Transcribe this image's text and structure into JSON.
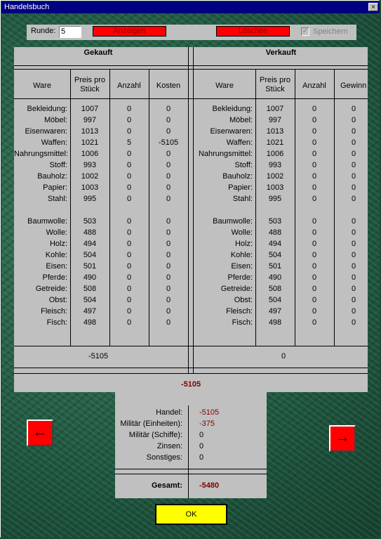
{
  "window": {
    "title": "Handelsbuch",
    "close_glyph": "×"
  },
  "top": {
    "runde_label": "Runde:",
    "runde_value": "5",
    "anzeigen_label": "Anzeigen",
    "loeschen_label": "Löschen",
    "speichern_label": "Speichern",
    "speichern_checked": true
  },
  "bought": {
    "title": "Gekauft",
    "headers": {
      "ware": "Ware",
      "preis": "Preis pro Stück",
      "anzahl": "Anzahl",
      "kosten": "Kosten"
    },
    "rows": [
      {
        "ware": "Bekleidung:",
        "preis": "1007",
        "anzahl": "0",
        "wert": "0"
      },
      {
        "ware": "Möbel:",
        "preis": "997",
        "anzahl": "0",
        "wert": "0"
      },
      {
        "ware": "Eisenwaren:",
        "preis": "1013",
        "anzahl": "0",
        "wert": "0"
      },
      {
        "ware": "Waffen:",
        "preis": "1021",
        "anzahl": "5",
        "wert": "-5105"
      },
      {
        "ware": "Nahrungsmittel:",
        "preis": "1006",
        "anzahl": "0",
        "wert": "0"
      },
      {
        "ware": "Stoff:",
        "preis": "993",
        "anzahl": "0",
        "wert": "0"
      },
      {
        "ware": "Bauholz:",
        "preis": "1002",
        "anzahl": "0",
        "wert": "0"
      },
      {
        "ware": "Papier:",
        "preis": "1003",
        "anzahl": "0",
        "wert": "0"
      },
      {
        "ware": "Stahl:",
        "preis": "995",
        "anzahl": "0",
        "wert": "0"
      },
      {
        "ware": "Baumwolle:",
        "preis": "503",
        "anzahl": "0",
        "wert": "0"
      },
      {
        "ware": "Wolle:",
        "preis": "488",
        "anzahl": "0",
        "wert": "0"
      },
      {
        "ware": "Holz:",
        "preis": "494",
        "anzahl": "0",
        "wert": "0"
      },
      {
        "ware": "Kohle:",
        "preis": "504",
        "anzahl": "0",
        "wert": "0"
      },
      {
        "ware": "Eisen:",
        "preis": "501",
        "anzahl": "0",
        "wert": "0"
      },
      {
        "ware": "Pferde:",
        "preis": "490",
        "anzahl": "0",
        "wert": "0"
      },
      {
        "ware": "Getreide:",
        "preis": "508",
        "anzahl": "0",
        "wert": "0"
      },
      {
        "ware": "Obst:",
        "preis": "504",
        "anzahl": "0",
        "wert": "0"
      },
      {
        "ware": "Fleisch:",
        "preis": "497",
        "anzahl": "0",
        "wert": "0"
      },
      {
        "ware": "Fisch:",
        "preis": "498",
        "anzahl": "0",
        "wert": "0"
      }
    ],
    "total": "-5105"
  },
  "sold": {
    "title": "Verkauft",
    "headers": {
      "ware": "Ware",
      "preis": "Preis pro Stück",
      "anzahl": "Anzahl",
      "gewinn": "Gewinn"
    },
    "rows": [
      {
        "ware": "Bekleidung:",
        "preis": "1007",
        "anzahl": "0",
        "wert": "0"
      },
      {
        "ware": "Möbel:",
        "preis": "997",
        "anzahl": "0",
        "wert": "0"
      },
      {
        "ware": "Eisenwaren:",
        "preis": "1013",
        "anzahl": "0",
        "wert": "0"
      },
      {
        "ware": "Waffen:",
        "preis": "1021",
        "anzahl": "0",
        "wert": "0"
      },
      {
        "ware": "Nahrungsmittel:",
        "preis": "1006",
        "anzahl": "0",
        "wert": "0"
      },
      {
        "ware": "Stoff:",
        "preis": "993",
        "anzahl": "0",
        "wert": "0"
      },
      {
        "ware": "Bauholz:",
        "preis": "1002",
        "anzahl": "0",
        "wert": "0"
      },
      {
        "ware": "Papier:",
        "preis": "1003",
        "anzahl": "0",
        "wert": "0"
      },
      {
        "ware": "Stahl:",
        "preis": "995",
        "anzahl": "0",
        "wert": "0"
      },
      {
        "ware": "Baumwolle:",
        "preis": "503",
        "anzahl": "0",
        "wert": "0"
      },
      {
        "ware": "Wolle:",
        "preis": "488",
        "anzahl": "0",
        "wert": "0"
      },
      {
        "ware": "Holz:",
        "preis": "494",
        "anzahl": "0",
        "wert": "0"
      },
      {
        "ware": "Kohle:",
        "preis": "504",
        "anzahl": "0",
        "wert": "0"
      },
      {
        "ware": "Eisen:",
        "preis": "501",
        "anzahl": "0",
        "wert": "0"
      },
      {
        "ware": "Pferde:",
        "preis": "490",
        "anzahl": "0",
        "wert": "0"
      },
      {
        "ware": "Getreide:",
        "preis": "508",
        "anzahl": "0",
        "wert": "0"
      },
      {
        "ware": "Obst:",
        "preis": "504",
        "anzahl": "0",
        "wert": "0"
      },
      {
        "ware": "Fleisch:",
        "preis": "497",
        "anzahl": "0",
        "wert": "0"
      },
      {
        "ware": "Fisch:",
        "preis": "498",
        "anzahl": "0",
        "wert": "0"
      }
    ],
    "total": "0"
  },
  "net_total": "-5105",
  "summary": {
    "rows": [
      {
        "label": "Handel:",
        "value": "-5105"
      },
      {
        "label": "Militär (Einheiten):",
        "value": "-375"
      },
      {
        "label": "Militär (Schiffe):",
        "value": "0"
      },
      {
        "label": "Zinsen:",
        "value": "0"
      },
      {
        "label": "Sonstiges:",
        "value": "0"
      }
    ],
    "gesamt_label": "Gesamt:",
    "gesamt_value": "-5480"
  },
  "nav": {
    "prev_glyph": "←",
    "next_glyph": "→"
  },
  "ok_label": "OK",
  "colors": {
    "negative": "#800000",
    "button_red": "#ff0000",
    "ok_yellow": "#ffff00"
  }
}
